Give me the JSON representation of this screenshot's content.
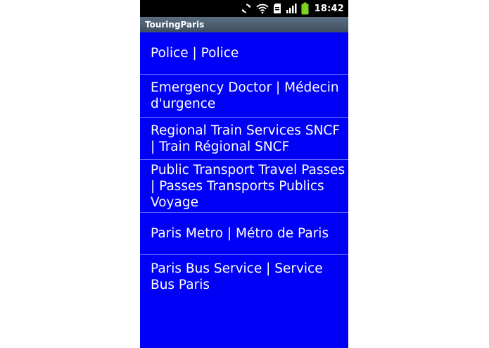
{
  "status_bar": {
    "time": "18:42",
    "icons": [
      "sync-icon",
      "wifi-icon",
      "sd-card-icon",
      "signal-icon",
      "battery-icon"
    ],
    "icon_color": "#ffffff",
    "battery_color": "#7ed321"
  },
  "app": {
    "title": "TouringParis",
    "background_color": "#0000f6"
  },
  "list": {
    "items": [
      {
        "label": "Police | Police"
      },
      {
        "label": "Emergency Doctor | Médecin d'urgence"
      },
      {
        "label": "Regional Train Services SNCF | Train Régional SNCF"
      },
      {
        "label": "Public Transport Travel Passes | Passes Transports Publics Voyage"
      },
      {
        "label": "Paris Metro | Métro de Paris"
      },
      {
        "label": "Paris Bus Service | Service Bus Paris"
      }
    ]
  }
}
